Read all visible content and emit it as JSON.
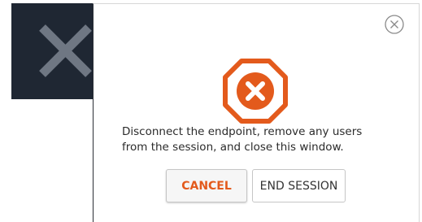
{
  "background": {
    "icon": "close-x-icon"
  },
  "dialog": {
    "close_icon": "close-circle-icon",
    "warning_icon": "octagon-x-icon",
    "message_line1": "Disconnect the endpoint, remove any users",
    "message_line2": "from the session, and close this window.",
    "cancel_label": "CANCEL",
    "end_session_label": "END SESSION"
  },
  "colors": {
    "accent": "#e35a1c",
    "background_panel": "#1f2733"
  }
}
